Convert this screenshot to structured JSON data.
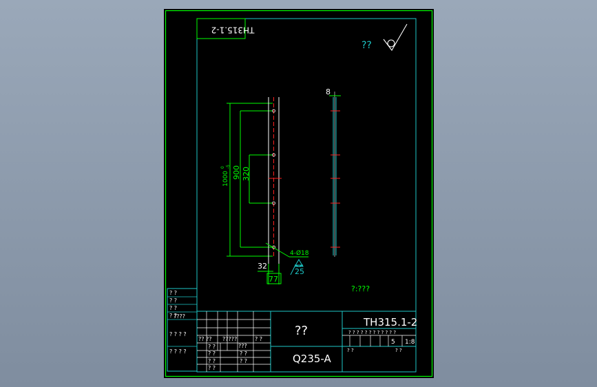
{
  "drawing": {
    "rev_tag": "TH315.1-2",
    "roughness": "??",
    "note": "?:???",
    "drawing_no": "TH315.1-2",
    "part_name": "??",
    "material": "Q235-A",
    "scale_value": "1:8",
    "qty_value": "5"
  },
  "dims": {
    "length": "1000",
    "tol_upper": "0",
    "tol_lower": "-5",
    "span": "900",
    "pitch": "320",
    "edge": "32",
    "width": "77",
    "holes": "4-Ø18",
    "weld": "25",
    "thickness": "8"
  },
  "side_block": {
    "rows": [
      "? ?",
      "? ?",
      "? ?",
      "? ?",
      "????",
      "? ? ? ?",
      "? ? ?   ?"
    ]
  },
  "title_block": {
    "label_a": "?? ??",
    "label_b": "?????",
    "label_c": "? ?",
    "label_d": "???",
    "label_e": "? ?",
    "label_f": "? ?",
    "label_g": "? ?",
    "label_h": "? ?",
    "label_i": "? ?",
    "label_j": "? ?",
    "scale_row": "? ?    ? ?    ? ?    ? ?    ? ?  ? ?",
    "footer_left": "? ?",
    "footer_right": "? ?"
  },
  "colors": {
    "sheet_bg": "#000000",
    "border": "#00ff00",
    "cyan": "#1ec8c8",
    "red": "#ff2020",
    "white": "#ffffff",
    "workspace": "#8e9cae"
  }
}
